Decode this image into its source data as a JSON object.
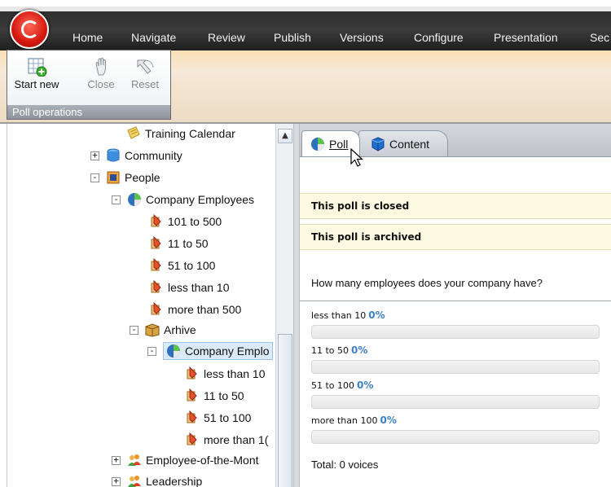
{
  "menu": {
    "items": [
      "Home",
      "Navigate",
      "Review",
      "Publish",
      "Versions",
      "Configure",
      "Presentation",
      "Sec"
    ]
  },
  "ribbon": {
    "group_label": "Poll operations",
    "buttons": [
      {
        "label": "Start new",
        "icon": "grid-add-icon",
        "enabled": true
      },
      {
        "label": "Close",
        "icon": "hand-icon",
        "enabled": false
      },
      {
        "label": "Reset",
        "icon": "reset-arrow-icon",
        "enabled": false
      }
    ]
  },
  "tree": {
    "nodes": [
      {
        "label": "Training Calendar",
        "icon": "calendar-icon"
      },
      {
        "label": "Community",
        "icon": "database-icon",
        "expander": "+"
      },
      {
        "label": "People",
        "icon": "folder-icon",
        "expander": "-"
      },
      {
        "label": "Company Employees",
        "icon": "poll-icon",
        "expander": "-"
      },
      {
        "label": "101 to 500",
        "icon": "answer-icon"
      },
      {
        "label": "11 to 50",
        "icon": "answer-icon"
      },
      {
        "label": "51 to 100",
        "icon": "answer-icon"
      },
      {
        "label": "less than 10",
        "icon": "answer-icon"
      },
      {
        "label": "more than 500",
        "icon": "answer-icon"
      },
      {
        "label": "Arhive",
        "icon": "archive-box-icon",
        "expander": "-"
      },
      {
        "label": "Company Emplo",
        "icon": "poll-icon",
        "expander": "-",
        "selected": true
      },
      {
        "label": "less than 10",
        "icon": "answer-icon"
      },
      {
        "label": "11 to 50",
        "icon": "answer-icon"
      },
      {
        "label": "51 to 100",
        "icon": "answer-icon"
      },
      {
        "label": "more than 1(",
        "icon": "answer-icon"
      },
      {
        "label": "Employee-of-the-Mont",
        "icon": "people-icon",
        "expander": "+"
      },
      {
        "label": "Leadership",
        "icon": "people-icon",
        "expander": "+"
      }
    ]
  },
  "tabs": [
    {
      "label": "Poll",
      "icon": "poll-icon",
      "active": true
    },
    {
      "label": "Content",
      "icon": "cube-icon",
      "active": false
    }
  ],
  "poll": {
    "notice_closed": "This poll is closed",
    "notice_archived": "This poll is archived",
    "question": "How many employees does your company have?",
    "answers": [
      {
        "text": "less than 10",
        "percent": "0%",
        "fraction": 0
      },
      {
        "text": "11 to 50",
        "percent": "0%",
        "fraction": 0
      },
      {
        "text": "51 to 100",
        "percent": "0%",
        "fraction": 0
      },
      {
        "text": "more than 100",
        "percent": "0%",
        "fraction": 0
      }
    ],
    "total": "Total: 0 voices"
  },
  "colors": {
    "ribbon_dark": "#2c2c2c",
    "notice_bg": "#fcfbe1",
    "percent_blue": "#3d7fc4",
    "selection": "#dbeaf8"
  }
}
